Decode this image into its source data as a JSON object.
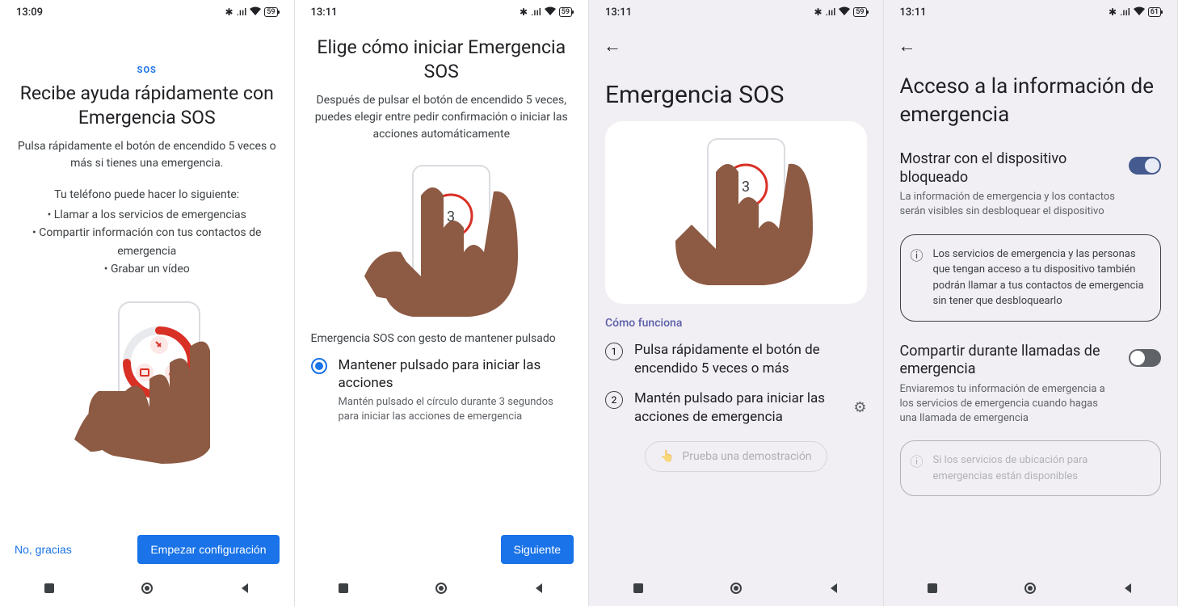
{
  "screen1": {
    "time": "13:09",
    "battery": "59",
    "sos_badge": "SOS",
    "title": "Recibe ayuda rápidamente con Emergencia SOS",
    "subtitle": "Pulsa rápidamente el botón de encendido 5 veces o más si tienes una emergencia.",
    "intro": "Tu teléfono puede hacer lo siguiente:",
    "bullet1": "• Llamar a los servicios de emergencias",
    "bullet2": "• Compartir información con tus contactos de emergencia",
    "bullet3": "• Grabar un vídeo",
    "no_thanks": "No, gracias",
    "start_setup": "Empezar configuración"
  },
  "screen2": {
    "time": "13:11",
    "battery": "59",
    "title": "Elige cómo iniciar Emergencia SOS",
    "subtitle": "Después de pulsar el botón de encendido 5 veces, puedes elegir entre pedir confirmación o iniciar las acciones automáticamente",
    "illus_count": "3",
    "section_label": "Emergencia SOS con gesto de mantener pulsado",
    "radio_title": "Mantener pulsado para iniciar las acciones",
    "radio_desc": "Mantén pulsado el círculo durante 3 segundos para iniciar las acciones de emergencia",
    "next": "Siguiente"
  },
  "screen3": {
    "time": "13:11",
    "battery": "59",
    "title": "Emergencia SOS",
    "illus_count": "3",
    "how_label": "Cómo funciona",
    "step1": "Pulsa rápidamente el botón de encendido 5 veces o más",
    "step2": "Mantén pulsado para iniciar las acciones de emergencia",
    "demo": "Prueba una demostración"
  },
  "screen4": {
    "time": "13:11",
    "battery": "61",
    "title": "Acceso a la información de emergencia",
    "setting1_title": "Mostrar con el dispositivo bloqueado",
    "setting1_desc": "La información de emergencia y los contactos serán visibles sin desbloquear el dispositivo",
    "info1": "Los servicios de emergencia y las personas que tengan acceso a tu dispositivo también podrán llamar a tus contactos de emergencia sin tener que desbloquearlo",
    "setting2_title": "Compartir durante llamadas de emergencia",
    "setting2_desc": "Enviaremos tu información de emergencia a los servicios de emergencia cuando hagas una llamada de emergencia",
    "info2": "Si los servicios de ubicación para emergencias están disponibles"
  }
}
